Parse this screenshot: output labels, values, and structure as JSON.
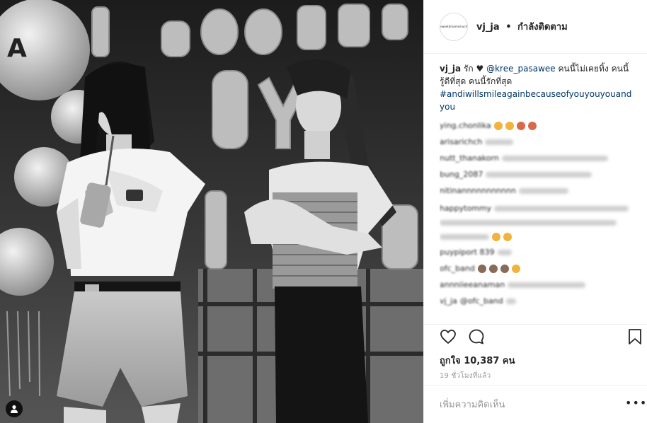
{
  "post": {
    "username": "vj_ja",
    "follow_status": "กำลังติดตาม",
    "separator": "•",
    "avatar_text": "sweetdreamsmuch"
  },
  "caption": {
    "username": "vj_ja",
    "text_before": "รัก ♥",
    "mention": "@kree_pasawee",
    "text_after": "คนนี้ไม่เคยทิ้ง คนนี้รู้ดีที่สุด คนนี้รักที่สุด",
    "hashtag": "#andiwillsmileagainbecauseofyouyouyouandyou"
  },
  "comments": [
    {
      "handle": "ying.chonlika"
    },
    {
      "handle": "arisarichch"
    },
    {
      "handle": "nutt_thanakorn"
    },
    {
      "handle": "bung_2087"
    },
    {
      "handle": "nitinannnnnnnnnnn"
    },
    {
      "handle": "happytommy"
    },
    {
      "handle": "puypiport 839"
    },
    {
      "handle": "ofc_band"
    },
    {
      "handle": "annniieeanaman"
    },
    {
      "handle": "vj_ja",
      "mention": "@ofc_band"
    }
  ],
  "actions": {
    "like_icon": "heart-icon",
    "comment_icon": "comment-bubble-icon",
    "save_icon": "bookmark-icon"
  },
  "likes_text": "ถูกใจ 10,387 คน",
  "timestamp": "19 ชั่วโมงที่แล้ว",
  "add_comment_placeholder": "เพิ่มความคิดเห็น",
  "more_options": "•••",
  "colors": {
    "link": "#003569",
    "muted": "#999999",
    "border": "#efefef",
    "text": "#262626"
  }
}
